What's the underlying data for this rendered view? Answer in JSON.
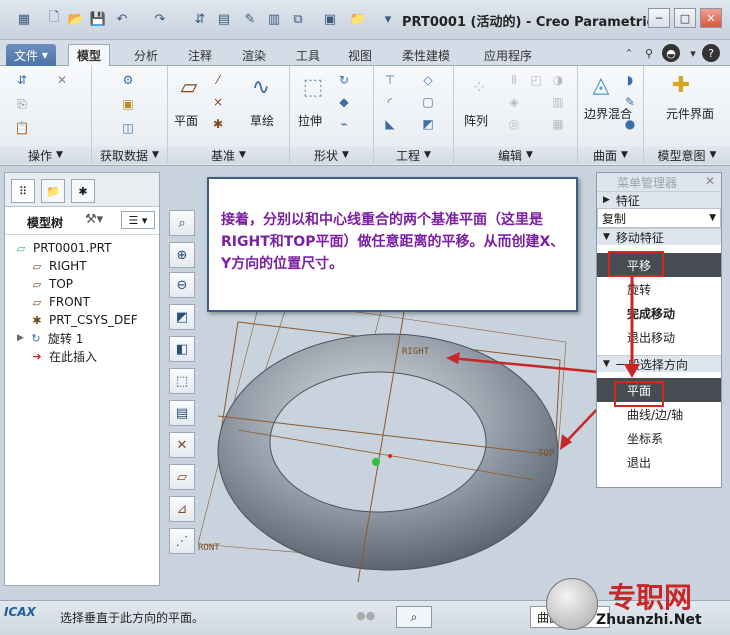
{
  "titlebar": {
    "title": "PRT0001 (活动的) - Creo Parametric",
    "minimize": "─",
    "maximize": "□",
    "close": "✕"
  },
  "tabs": [
    "文件",
    "模型",
    "分析",
    "注释",
    "渲染",
    "工具",
    "视图",
    "柔性建模",
    "应用程序"
  ],
  "ribbon": {
    "groups": [
      {
        "label": "操作"
      },
      {
        "label": "获取数据"
      },
      {
        "label": "基准",
        "big": "平面",
        "big2": "草绘"
      },
      {
        "label": "形状",
        "big": "拉伸"
      },
      {
        "label": "工程"
      },
      {
        "label": "编辑",
        "big": "阵列"
      },
      {
        "label": "曲面",
        "big": "边界混合"
      },
      {
        "label": "模型意图",
        "big": "元件界面"
      }
    ]
  },
  "leftpanel": {
    "tree_title": "模型树",
    "items": [
      {
        "icon": "part-icon",
        "label": "PRT0001.PRT"
      },
      {
        "icon": "datum-plane-icon",
        "label": "RIGHT"
      },
      {
        "icon": "datum-plane-icon",
        "label": "TOP"
      },
      {
        "icon": "datum-plane-icon",
        "label": "FRONT"
      },
      {
        "icon": "csys-icon",
        "label": "PRT_CSYS_DEF"
      },
      {
        "icon": "revolve-icon",
        "label": "旋转 1"
      },
      {
        "icon": "insert-arrow-icon",
        "label": "在此插入"
      }
    ]
  },
  "callout": {
    "text": "接着，分别以和中心线重合的两个基准平面（这里是RIGHT和TOP平面）做任意距离的平移。从而创建X、Y方向的位置尺寸。"
  },
  "graphics": {
    "plane_labels": {
      "right": "RIGHT",
      "top": "TOP",
      "front": "RONT"
    }
  },
  "menumgr": {
    "title": "菜单管理器",
    "section1": "特征",
    "dropdown": "复制",
    "section2": "移动特征",
    "items1": [
      "平移",
      "旋转",
      "完成移动",
      "退出移动"
    ],
    "section3": "一般选择方向",
    "items2": [
      "平面",
      "曲线/边/轴",
      "坐标系",
      "退出"
    ]
  },
  "statusbar": {
    "message": "选择垂直于此方向的平面。",
    "filter": "曲面"
  },
  "watermark": {
    "site": "专职网",
    "url": "Zhuanzhi.Net",
    "left_logo": "ICAX"
  }
}
